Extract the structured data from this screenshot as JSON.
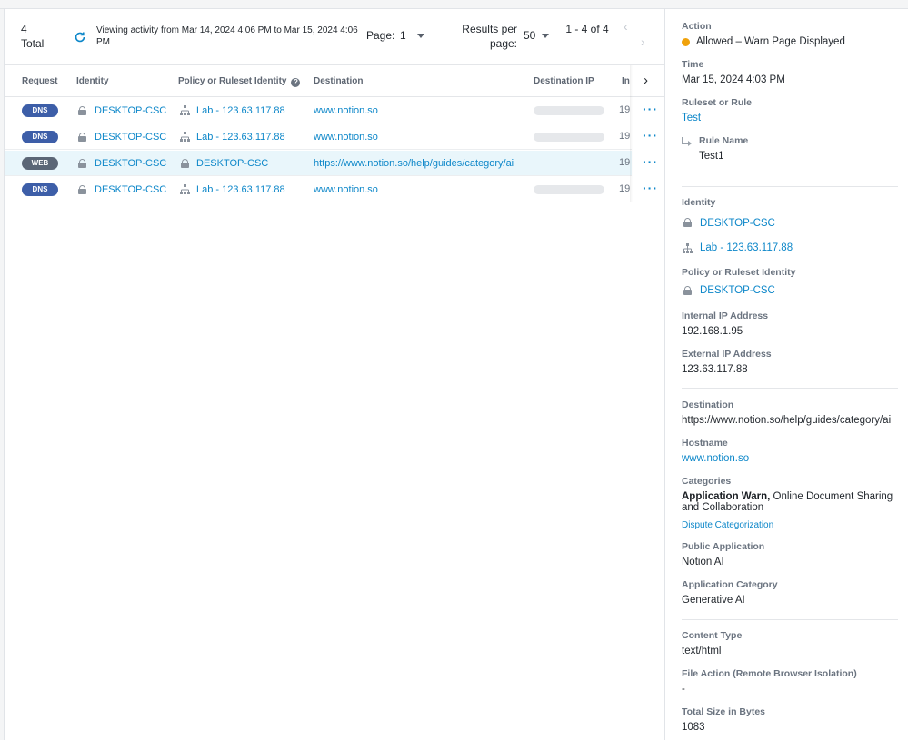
{
  "toolbar": {
    "total_count": "4",
    "total_label": "Total",
    "viewing_text": "Viewing activity from Mar 14, 2024 4:06 PM to Mar 15, 2024 4:06 PM",
    "page_label": "Page:",
    "page_value": "1",
    "results_per_page_label": "Results per page:",
    "results_per_page_value": "50",
    "range_text": "1 - 4 of 4"
  },
  "table": {
    "columns": [
      "Request",
      "Identity",
      "Policy or Ruleset Identity",
      "Destination",
      "Destination IP",
      "In"
    ],
    "rows": [
      {
        "request": "DNS",
        "identity": "DESKTOP-CSC",
        "policy_icon": "network-icon",
        "policy": "Lab - 123.63.117.88",
        "destination": "www.notion.so",
        "ip_clip": "19",
        "selected": false
      },
      {
        "request": "DNS",
        "identity": "DESKTOP-CSC",
        "policy_icon": "network-icon",
        "policy": "Lab - 123.63.117.88",
        "destination": "www.notion.so",
        "ip_clip": "19",
        "selected": false
      },
      {
        "request": "WEB",
        "identity": "DESKTOP-CSC",
        "policy_icon": "lock-icon",
        "policy": "DESKTOP-CSC",
        "destination": "https://www.notion.so/help/guides/category/ai",
        "ip_clip": "19",
        "selected": true
      },
      {
        "request": "DNS",
        "identity": "DESKTOP-CSC",
        "policy_icon": "network-icon",
        "policy": "Lab - 123.63.117.88",
        "destination": "www.notion.so",
        "ip_clip": "19",
        "selected": false
      }
    ]
  },
  "details": {
    "action_label": "Action",
    "action_value": "Allowed – Warn Page Displayed",
    "time_label": "Time",
    "time_value": "Mar 15, 2024 4:03 PM",
    "ruleset_label": "Ruleset or Rule",
    "ruleset_value": "Test",
    "rule_name_label": "Rule Name",
    "rule_name_value": "Test1",
    "identity_label": "Identity",
    "identity_1": "DESKTOP-CSC",
    "identity_2": "Lab - 123.63.117.88",
    "policy_label": "Policy or Ruleset Identity",
    "policy_value": "DESKTOP-CSC",
    "internal_ip_label": "Internal IP Address",
    "internal_ip_value": "192.168.1.95",
    "external_ip_label": "External IP Address",
    "external_ip_value": "123.63.117.88",
    "destination_label": "Destination",
    "destination_value": "https://www.notion.so/help/guides/category/ai",
    "hostname_label": "Hostname",
    "hostname_value": "www.notion.so",
    "categories_label": "Categories",
    "categories_bold": "Application Warn,",
    "categories_rest": " Online Document Sharing and Collaboration",
    "dispute_label": "Dispute Categorization",
    "public_app_label": "Public Application",
    "public_app_value": "Notion AI",
    "app_category_label": "Application Category",
    "app_category_value": "Generative AI",
    "content_type_label": "Content Type",
    "content_type_value": "text/html",
    "file_action_label": "File Action (Remote Browser Isolation)",
    "file_action_value": "-",
    "total_size_label": "Total Size in Bytes",
    "total_size_value": "1083"
  },
  "colors": {
    "link": "#0d87c9",
    "dns_badge": "#3d5ea8",
    "web_badge": "#5b6676",
    "warn": "#f0a20b",
    "selected_row": "#e9f6fb"
  }
}
